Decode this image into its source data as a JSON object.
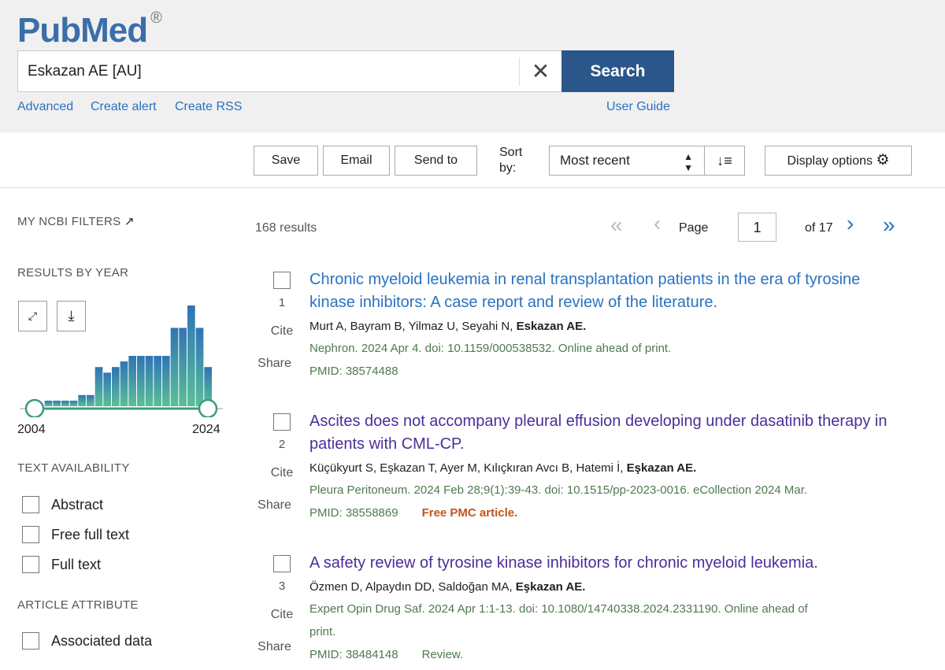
{
  "header": {
    "logo": "PubMed",
    "logo_mark": "®",
    "query": "Eskazan AE [AU]",
    "search_label": "Search",
    "links": [
      "Advanced",
      "Create alert",
      "Create RSS"
    ],
    "user_guide": "User Guide"
  },
  "toolbar": {
    "save": "Save",
    "email": "Email",
    "send_to": "Send to",
    "sort_label_1": "Sort",
    "sort_label_2": "by:",
    "sort_value": "Most recent",
    "display_options": "Display options"
  },
  "sidebar": {
    "my_ncbi": "MY NCBI FILTERS",
    "results_by_year": "RESULTS BY YEAR",
    "text_availability": "TEXT AVAILABILITY",
    "text_filters": [
      "Abstract",
      "Free full text",
      "Full text"
    ],
    "article_attribute": "ARTICLE ATTRIBUTE",
    "attr_filters": [
      "Associated data"
    ]
  },
  "chart_data": {
    "type": "bar",
    "years": [
      2004,
      2005,
      2006,
      2007,
      2008,
      2009,
      2010,
      2011,
      2012,
      2013,
      2014,
      2015,
      2016,
      2017,
      2018,
      2019,
      2020,
      2021,
      2022,
      2023,
      2024
    ],
    "values": [
      0,
      1,
      1,
      1,
      1,
      2,
      2,
      7,
      6,
      7,
      8,
      9,
      9,
      9,
      9,
      9,
      14,
      14,
      18,
      14,
      7
    ],
    "range_start_label": "2004",
    "range_end_label": "2024",
    "colors": {
      "top": "#2f74b5",
      "bottom": "#5bbf98"
    }
  },
  "results_summary": {
    "count": "168 results",
    "page_label": "Page",
    "page": "1",
    "of": "of 17"
  },
  "results": [
    {
      "num": "1",
      "title": "Chronic myeloid leukemia in renal transplantation patients in the era of tyrosine kinase inhibitors: A case report and review of the literature.",
      "authors": "Murt A, Bayram B, Yilmaz U, Seyahi N, ",
      "author_bold": "Eskazan AE.",
      "citation": "Nephron. 2024 Apr 4. doi: 10.1159/000538532. Online ahead of print.",
      "citation2": "",
      "pmid": "PMID: 38574488",
      "badge": "",
      "title_color": "#2a72c0"
    },
    {
      "num": "2",
      "title": "Ascites does not accompany pleural effusion developing under dasatinib therapy in patients with CML-CP.",
      "authors": "Küçükyurt S, Eşkazan T, Ayer M, Kılıçkıran Avcı B, Hatemi İ, ",
      "author_bold": "Eşkazan AE.",
      "citation": "Pleura Peritoneum. 2024 Feb 28;9(1):39-43. doi: 10.1515/pp-2023-0016. eCollection 2024 Mar.",
      "citation2": "",
      "pmid": "PMID: 38558869",
      "badge": "Free PMC article.",
      "title_color": "#4b2e9a"
    },
    {
      "num": "3",
      "title": "A safety review of tyrosine kinase inhibitors for chronic myeloid leukemia.",
      "authors": "Özmen D, Alpaydın DD, Saldoğan MA, ",
      "author_bold": "Eşkazan AE.",
      "citation": "Expert Opin Drug Saf. 2024 Apr 1:1-13. doi: 10.1080/14740338.2024.2331190. Online ahead of",
      "citation2": "print.",
      "pmid": "PMID: 38484148",
      "badge": "Review.",
      "title_color": "#4b2e9a"
    }
  ],
  "actions": {
    "cite": "Cite",
    "share": "Share"
  }
}
